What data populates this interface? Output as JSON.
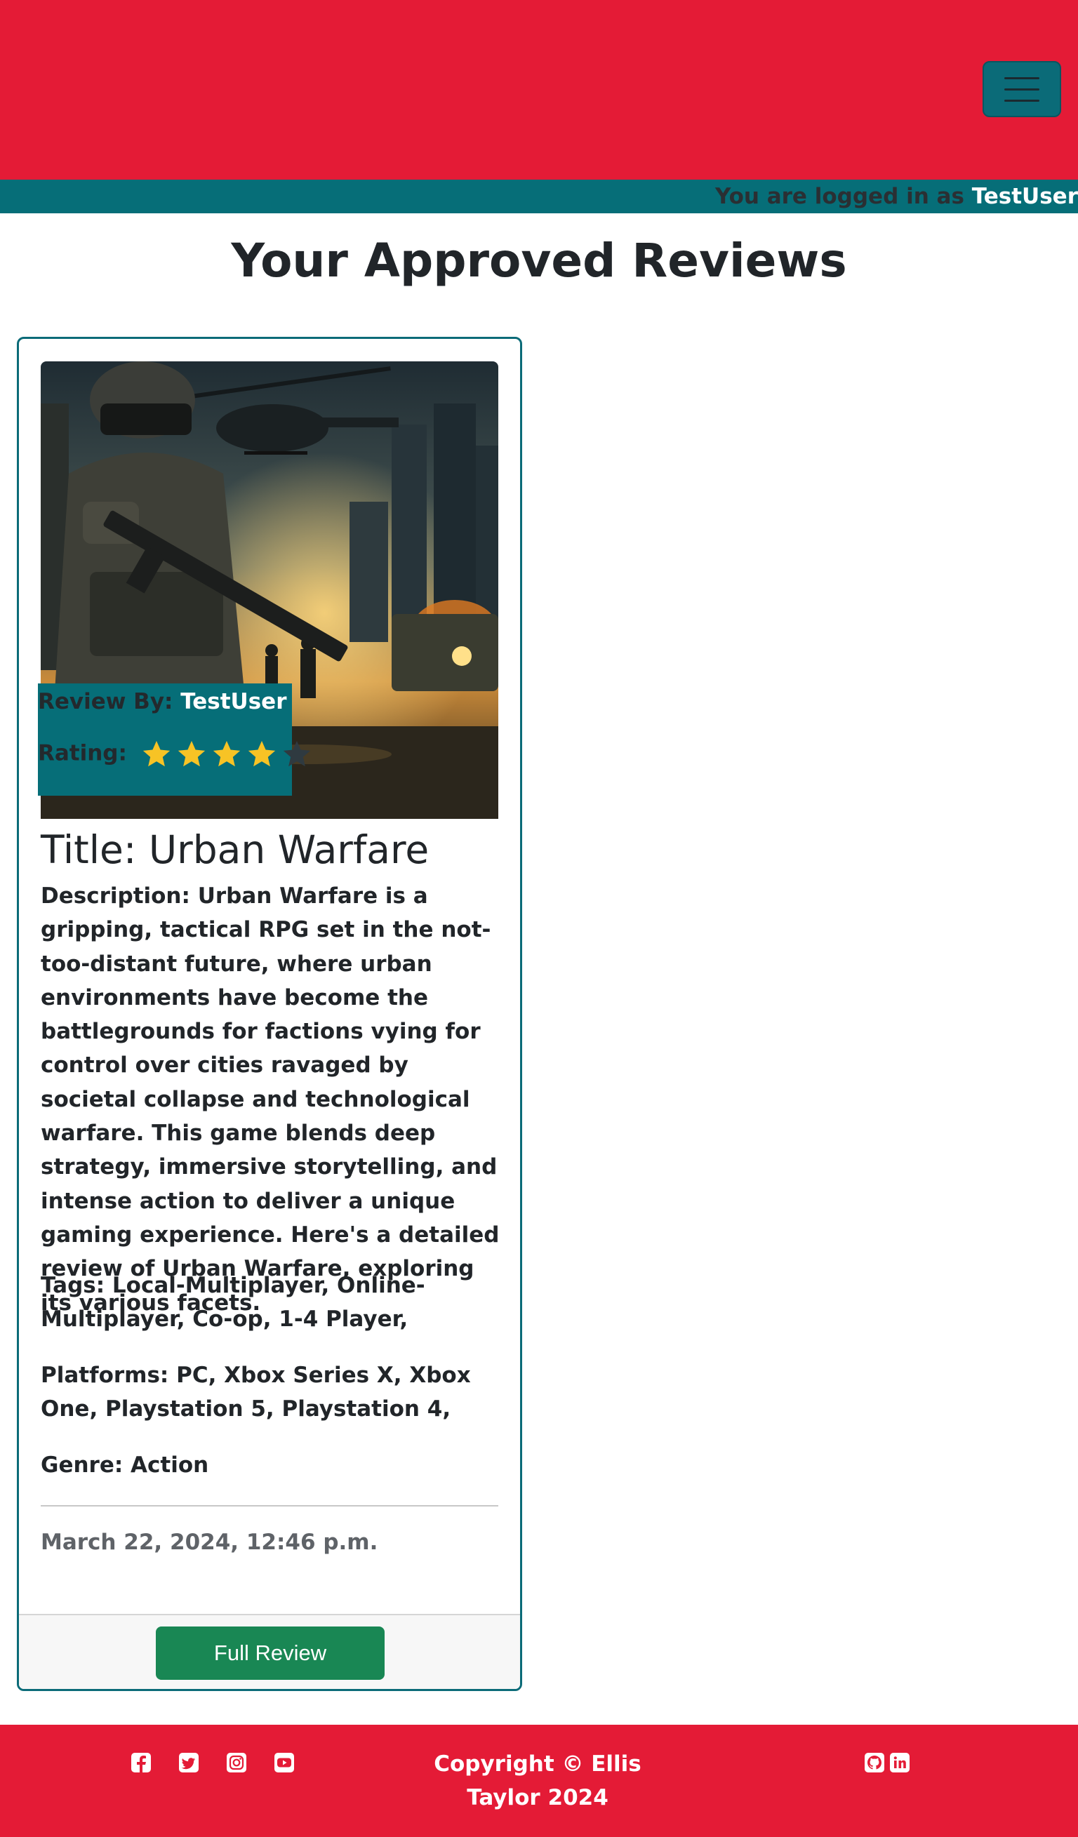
{
  "navbar": {
    "menu_icon": "hamburger-menu-icon",
    "bg_color": "#e41b36"
  },
  "login": {
    "prefix": "You are logged in as",
    "username": "TestUser"
  },
  "page": {
    "title": "Your Approved Reviews"
  },
  "review": {
    "image_icon": "soldier-helicopter-game-art",
    "review_by_label": "Review By:",
    "reviewer": "TestUser",
    "rating_label": "Rating:",
    "rating": 4,
    "rating_max": 5,
    "title": "Title: Urban Warfare",
    "description": "Description: Urban Warfare is a gripping, tactical RPG set in the not-too-distant future, where urban environments have become the battlegrounds for factions vying for control over cities ravaged by societal collapse and technological warfare. This game blends deep strategy, immersive storytelling, and intense action to deliver a unique gaming experience. Here's a detailed review of Urban Warfare, exploring its various facets.",
    "tags": "Tags: Local-Multiplayer, Online-Multiplayer, Co-op, 1-4 Player,",
    "platforms": "Platforms: PC, Xbox Series X, Xbox One, Playstation 5, Playstation 4,",
    "genre": "Genre: Action",
    "date": "March 22, 2024, 12:46 p.m.",
    "button_label": "Full Review"
  },
  "footer": {
    "copyright": "Copyright © Ellis Taylor 2024",
    "socials": [
      "facebook-icon",
      "twitter-icon",
      "instagram-icon",
      "youtube-icon"
    ],
    "dev_links": [
      "github-icon",
      "linkedin-icon"
    ]
  },
  "colors": {
    "brand_red": "#e41b36",
    "teal": "#066e78",
    "star_gold": "#f7c325",
    "star_empty": "#2f3a40",
    "button_green": "#198754"
  }
}
